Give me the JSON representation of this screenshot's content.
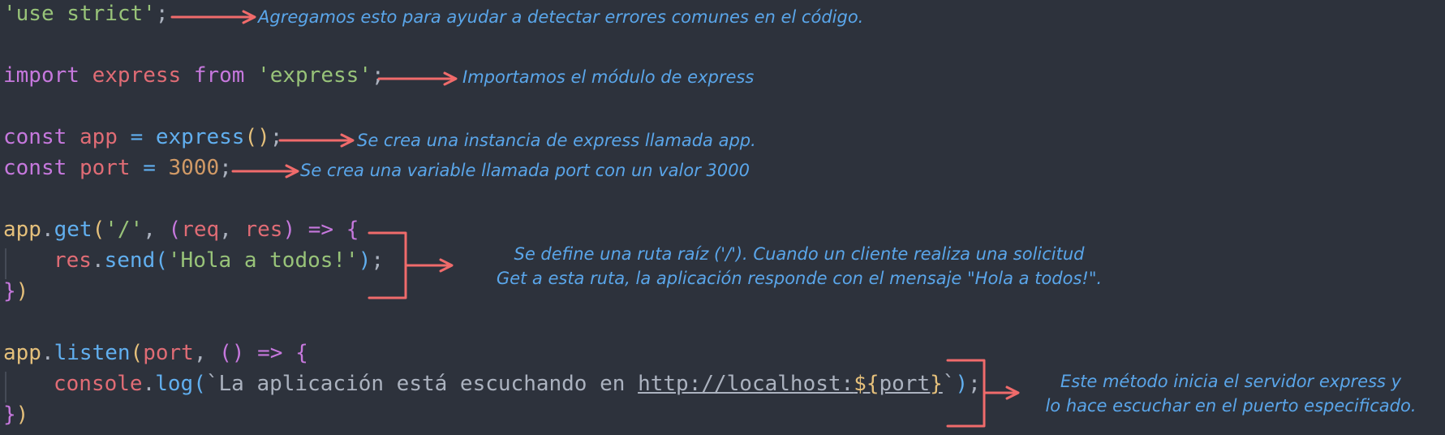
{
  "code": {
    "line1": {
      "s": "'use strict'",
      "p": ";"
    },
    "line2": {
      "k1": "import",
      "v": "express",
      "k2": "from",
      "s": "'express'",
      "p": ";"
    },
    "line3": {
      "k": "const",
      "v": "app",
      "eq": "=",
      "f": "express",
      "open": "(",
      "close": ")",
      "p": ";"
    },
    "line4": {
      "k": "const",
      "v": "port",
      "eq": "=",
      "n": "3000",
      "p": ";"
    },
    "line5": {
      "obj": "app",
      "dot": ".",
      "f": "get",
      "open": "(",
      "s": "'/'",
      "comma": ",",
      "popen": "(",
      "a1": "req",
      "comma2": ",",
      "a2": "res",
      "pclose": ")",
      "arrow": "=>",
      "brace": "{"
    },
    "line6": {
      "obj": "res",
      "dot": ".",
      "f": "send",
      "open": "(",
      "s": "'Hola a todos!'",
      "close": ")",
      "p": ";"
    },
    "line7": {
      "brace": "}",
      "paren": ")"
    },
    "line8": {
      "obj": "app",
      "dot": ".",
      "f": "listen",
      "open": "(",
      "v": "port",
      "comma": ",",
      "popen": "(",
      "pclose": ")",
      "arrow": "=>",
      "brace": "{"
    },
    "line9": {
      "obj": "console",
      "dot": ".",
      "f": "log",
      "open": "(",
      "tick": "`",
      "text": "La aplicación está escuchando en ",
      "url": "http://localhost:",
      "tpl_open": "${",
      "tpl_var": "port",
      "tpl_close": "}",
      "tick2": "`",
      "close": ")",
      "p": ";"
    },
    "line10": {
      "brace": "}",
      "paren": ")"
    }
  },
  "notes": {
    "n1": "Agregamos esto para ayudar a detectar errores comunes en el código.",
    "n2": "Importamos el módulo de express",
    "n3": "Se crea una instancia de express llamada app.",
    "n4": "Se crea una variable llamada port con un valor 3000",
    "n5a": "Se define una ruta raíz ('/'). Cuando un cliente realiza una solicitud",
    "n5b": "Get a esta ruta, la aplicación responde con el mensaje \"Hola a todos!\".",
    "n6a": "Este método inicia el servidor express y",
    "n6b": "lo hace escuchar en el puerto especificado."
  },
  "colors": {
    "background": "#2d323c",
    "annotation_text": "#5aa6ea",
    "arrow": "#f06b6b",
    "string": "#98c379",
    "keyword": "#c678dd",
    "variable": "#e06c75",
    "function": "#61afef",
    "number": "#d19a66"
  }
}
